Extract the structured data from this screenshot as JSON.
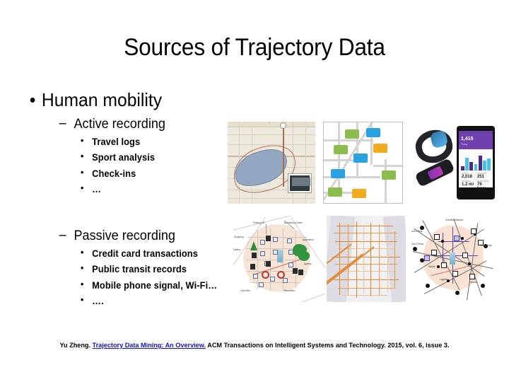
{
  "slide": {
    "title": "Sources of Trajectory Data",
    "background_color": "#ffffff",
    "text_color": "#000000"
  },
  "outline": {
    "level1": {
      "bullet_glyph": "•",
      "text": "Human mobility"
    },
    "sections": [
      {
        "dash_glyph": "–",
        "heading": "Active recording",
        "bullet_glyph": "•",
        "items": [
          "Travel logs",
          "Sport analysis",
          "Check-ins",
          "…"
        ]
      },
      {
        "dash_glyph": "–",
        "heading": "Passive recording",
        "bullet_glyph": "•",
        "items": [
          "Credit card transactions",
          "Public transit records",
          "Mobile phone signal, Wi-Fi…",
          "…."
        ]
      }
    ]
  },
  "figures": {
    "row_active": [
      {
        "name": "travel-log-map",
        "caption_implied": "Travel logs",
        "description": "Road map with GPS track around a lake and a geotagged photo thumbnail"
      },
      {
        "name": "check-in-map",
        "caption_implied": "Check-ins",
        "description": "Street map with colored speech-bubble check-in markers",
        "marker_colors": [
          "#8cbe4f",
          "#2aa2e0",
          "#f0ab1e"
        ]
      },
      {
        "name": "fitness-band-phone",
        "caption_implied": "Sport analysis",
        "description": "Wearable fitness band with companion phone app showing activity bar chart",
        "app_header_color": "#7040b0",
        "app_stats": [
          {
            "key": "STEPS",
            "value": "2,018"
          },
          {
            "key": "CALORIES",
            "value": "251"
          },
          {
            "key": "DISTANCE",
            "value": "1.2 mi"
          },
          {
            "key": "HEART RATE",
            "value": "76 bpm"
          }
        ],
        "app_chart_bars": [
          6,
          18,
          12,
          9,
          21,
          14,
          17
        ]
      }
    ],
    "row_passive": [
      {
        "name": "poi-illustrated-map",
        "caption_implied": "Credit card transactions",
        "description": "Illustrated city map with POI icons for shops, hotels and restaurants",
        "labels": [
          "Parking Lot",
          "Apartment & hotel",
          "Shopping",
          "Gallery",
          "Application",
          "Agency",
          "Cafe/Villa",
          "Recreation"
        ]
      },
      {
        "name": "transit-density-map",
        "caption_implied": "Public transit records",
        "description": "Street grid rendered as an orange traffic-density heat map",
        "accent_color": "#e08c3c"
      },
      {
        "name": "cellular-network-map",
        "caption_implied": "Mobile phone signal, Wi-Fi",
        "description": "Graph of cell-tower nodes and links overlaid on a city region",
        "labels": [
          "Shortest Distance",
          "Unit 1 Year",
          "Unit 2 Road",
          "Road entry",
          "Nature",
          "Logistic",
          "Outdoor"
        ]
      }
    ]
  },
  "footnote": {
    "author": "Yu Zheng.",
    "link_text": "Trajectory Data Mining: An Overview.",
    "link_color": "#1111cc",
    "rest": "ACM Transactions on Intelligent Systems and Technology. 2015, vol. 6, issue 3."
  }
}
